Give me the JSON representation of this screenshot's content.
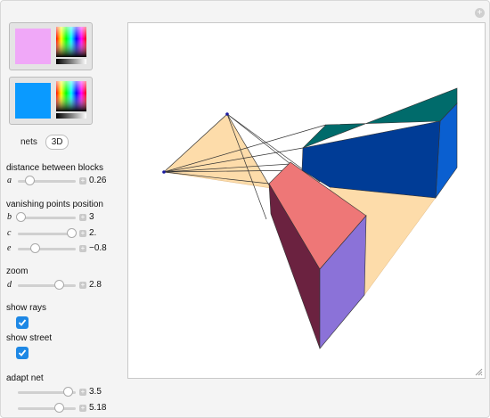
{
  "colors": {
    "swatch_1": "#f0a8f8",
    "swatch_2": "#0a9aff"
  },
  "tabs": {
    "nets_label": "nets",
    "threeD_label": "3D",
    "selected": "3D"
  },
  "sections": {
    "distance": "distance between blocks",
    "vanishing": "vanishing points position",
    "zoom": "zoom",
    "show_rays": "show rays",
    "show_street": "show street",
    "adapt_net": "adapt net"
  },
  "sliders": {
    "a": {
      "var": "a",
      "value": "0.26",
      "fraction": 0.1
    },
    "b": {
      "var": "b",
      "value": "3",
      "fraction": 0.05
    },
    "c": {
      "var": "c",
      "value": "2.",
      "fraction": 0.95
    },
    "e": {
      "var": "e",
      "value": "−0.8",
      "fraction": 0.3
    },
    "d": {
      "var": "d",
      "value": "2.8",
      "fraction": 0.75
    },
    "adapt1": {
      "value": "3.5",
      "fraction": 0.85
    },
    "adapt2": {
      "value": "5.18",
      "fraction": 0.7
    }
  },
  "checkboxes": {
    "show_rays": true,
    "show_street": true
  }
}
